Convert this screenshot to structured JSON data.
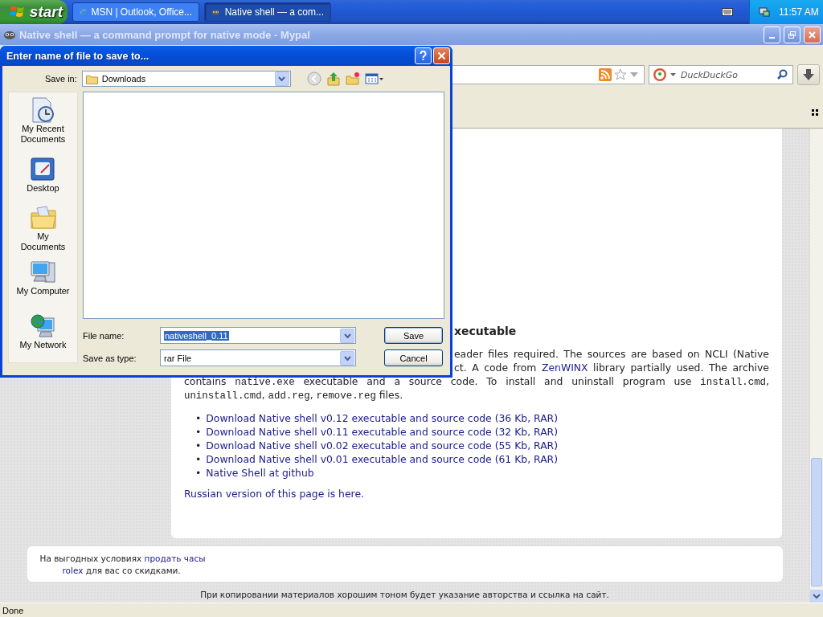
{
  "taskbar": {
    "start": "start",
    "tasks": [
      {
        "label": "MSN | Outlook, Office...",
        "kind": "ie",
        "selected": false
      },
      {
        "label": "Native shell — a com...",
        "kind": "browser",
        "selected": true
      }
    ],
    "clock": "11:57 AM"
  },
  "window": {
    "title": "Native shell — a command prompt for native mode - Mypal"
  },
  "toolbar": {
    "search": {
      "placeholder": "DuckDuckGo"
    }
  },
  "page": {
    "heading": "xecutable",
    "paragraph_lines": [
      {
        "segments": [
          {
            "kind": "text",
            "text": "eader files required. The sources are based on NCLI (Native"
          }
        ]
      },
      {
        "segments": [
          {
            "kind": "text",
            "text": "ct. A code from "
          },
          {
            "kind": "link",
            "text": "ZenWINX"
          },
          {
            "kind": "text",
            "text": " library partially used. The archive"
          }
        ]
      },
      {
        "segments": [
          {
            "kind": "text",
            "text": "contains "
          },
          {
            "kind": "code",
            "text": "native.exe"
          },
          {
            "kind": "text",
            "text": " executable and a source code. To install and uninstall program use "
          },
          {
            "kind": "code",
            "text": "install.cmd"
          },
          {
            "kind": "text",
            "text": ","
          }
        ]
      },
      {
        "segments": [
          {
            "kind": "code",
            "text": "uninstall.cmd"
          },
          {
            "kind": "text",
            "text": ", "
          },
          {
            "kind": "code",
            "text": "add.reg"
          },
          {
            "kind": "text",
            "text": ", "
          },
          {
            "kind": "code",
            "text": "remove.reg"
          },
          {
            "kind": "text",
            "text": " files."
          }
        ]
      }
    ],
    "links": [
      {
        "marker": "•",
        "text": "Download Native shell v0.12 executable and source code (36 Kb, RAR)"
      },
      {
        "marker": "•",
        "text": "Download Native shell v0.11 executable and source code (32 Kb, RAR)"
      },
      {
        "marker": "•",
        "text": "Download Native shell v0.02 executable and source code (55 Kb, RAR)"
      },
      {
        "marker": "•",
        "text": "Download Native shell v0.01 executable and source code (61 Kb, RAR)"
      },
      {
        "marker": "•",
        "text": "Native Shell at github"
      }
    ],
    "russian_link": "Russian version of this page is here."
  },
  "ad": {
    "lines": [
      {
        "segments": [
          {
            "kind": "text",
            "text": "На выгодных условиях "
          },
          {
            "kind": "link",
            "text": "продать часы"
          }
        ]
      },
      {
        "segments": [
          {
            "kind": "link",
            "text": "rolex"
          },
          {
            "kind": "text",
            "text": " для вас со скидками."
          }
        ]
      }
    ]
  },
  "footer": "При копировании материалов хорошим тоном будет указание авторства и ссылка на сайт.",
  "status_bar": "Done",
  "dialog": {
    "title": "Enter name of file to save to...",
    "save_in_label": "Save in:",
    "save_in": "Downloads",
    "places": [
      {
        "label": "My Recent Documents",
        "kind": "recent"
      },
      {
        "label": "Desktop",
        "kind": "desktop"
      },
      {
        "label": "My Documents",
        "kind": "documents"
      },
      {
        "label": "My Computer",
        "kind": "computer"
      },
      {
        "label": "My Network",
        "kind": "network"
      }
    ],
    "file_name_label": "File name:",
    "file_name": "nativeshell_0.11",
    "type_label": "Save as type:",
    "type": "rar File",
    "buttons": [
      "Save",
      "Cancel"
    ]
  }
}
